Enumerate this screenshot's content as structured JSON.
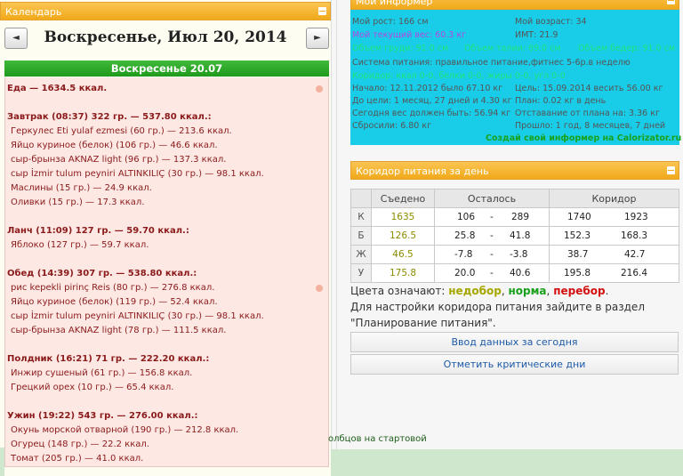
{
  "calendar": {
    "title": "Календарь",
    "prev": "◄",
    "next": "►",
    "date": "Воскресенье, Июл 20, 2014",
    "day_label": "Воскресенье 20.07"
  },
  "meals": {
    "lines": [
      {
        "t": "Еда — 1634.5 ккал.",
        "b": true
      },
      {
        "t": "Завтрак (08:37) 322 гр. — 537.80 ккал.:",
        "b": true
      },
      {
        "t": "Геркулес Eti yulaf ezmesi (60 гр.) — 213.6 ккал."
      },
      {
        "t": "Яйцо куриное (белок) (106 гр.) — 46.6 ккал."
      },
      {
        "t": "сыр-брынза AKNAZ light (96 гр.) — 137.3 ккал."
      },
      {
        "t": "сыр İzmir tulum peyniri ALTINKILIÇ (30 гр.) — 98.1 ккал."
      },
      {
        "t": "Маслины (15 гр.) — 24.9 ккал."
      },
      {
        "t": "Оливки (15 гр.) — 17.3 ккал."
      },
      {
        "t": "Ланч (11:09) 127 гр. — 59.70 ккал.:",
        "b": true
      },
      {
        "t": "Яблоко (127 гр.) — 59.7 ккал."
      },
      {
        "t": "Обед (14:39) 307 гр. — 538.80 ккал.:",
        "b": true
      },
      {
        "t": "рис kepekli pirinç Reis (80 гр.) — 276.8 ккал."
      },
      {
        "t": "Яйцо куриное (белок) (119 гр.) — 52.4 ккал."
      },
      {
        "t": "сыр İzmir tulum peyniri ALTINKILIÇ (30 гр.) — 98.1 ккал."
      },
      {
        "t": "сыр-брынза AKNAZ light (78 гр.) — 111.5 ккал."
      },
      {
        "t": "Полдник (16:21) 71 гр. — 222.20 ккал.:",
        "b": true
      },
      {
        "t": "Инжир сушеный (61 гр.) — 156.8 ккал."
      },
      {
        "t": "Грецкий орех (10 гр.) — 65.4 ккал."
      },
      {
        "t": "Ужин (19:22) 543 гр. — 276.00 ккал.:",
        "b": true
      },
      {
        "t": "Окунь морской отварной (190 гр.) — 212.8 ккал."
      },
      {
        "t": "Огурец (148 гр.) — 22.2 ккал."
      },
      {
        "t": "Томат (205 гр.) — 41.0 ккал."
      }
    ]
  },
  "bottom_text": "олбцов на стартовой",
  "informer": {
    "title": "Мой информер",
    "height": "Мой рост: 166 см",
    "age": "Мой возраст: 34",
    "weight": "Мой текущий вес: 60.3 кг",
    "bmi": "ИМТ: 21.9",
    "chest": "Объем груди: 91.0 см",
    "waist": "Объем талии: 69.0 см",
    "hips": "Объем бедер: 91.0 см",
    "system": "Система питания: правильное питание,фитнес 5-6р.в неделю",
    "corridor": "Коридор: ккал 0-0, белки 0-0, жиры 0-0, угл 0-0",
    "start": "Начало: 12.11.2012 было 67.10 кг",
    "goal": "Цель: 15.09.2014 весить 56.00 кг",
    "to_goal": "До цели: 1 месяц, 27 дней и 4.30 кг",
    "plan": "План: 0.02 кг в день",
    "today": "Сегодня вес должен быть: 56.94 кг",
    "lag": "Отставание от плана на: 3.36 кг",
    "lost": "Сбросили: 6.80 кг",
    "passed": "Прошло: 1 год, 8 месяцев, 7 дней",
    "create": "Создай свой информер на Calorizator.ru"
  },
  "corridor": {
    "title": "Коридор питания за день",
    "headers": [
      "Съедено",
      "Осталось",
      "Коридор"
    ],
    "rows": [
      {
        "l": "К",
        "eaten": "1635",
        "r1": "106",
        "r2": "289",
        "c1": "1740",
        "c2": "1923"
      },
      {
        "l": "Б",
        "eaten": "126.5",
        "r1": "25.8",
        "r2": "41.8",
        "c1": "152.3",
        "c2": "168.3"
      },
      {
        "l": "Ж",
        "eaten": "46.5",
        "r1": "-7.8",
        "r2": "-3.8",
        "c1": "38.7",
        "c2": "42.7"
      },
      {
        "l": "У",
        "eaten": "175.8",
        "r1": "20.0",
        "r2": "40.6",
        "c1": "195.8",
        "c2": "216.4"
      }
    ],
    "dash": "-",
    "legend_pre": "Цвета означают:",
    "legend_under": "недобор",
    "legend_norm": "норма",
    "legend_over": "перебор",
    "comma": ",",
    "dot": ".",
    "setup1": "Для настройки коридора питания зайдите в раздел",
    "setup2": "\"Планирование питания\".",
    "btn_input": "Ввод данных за сегодня",
    "btn_critical": "Отметить критические дни"
  }
}
